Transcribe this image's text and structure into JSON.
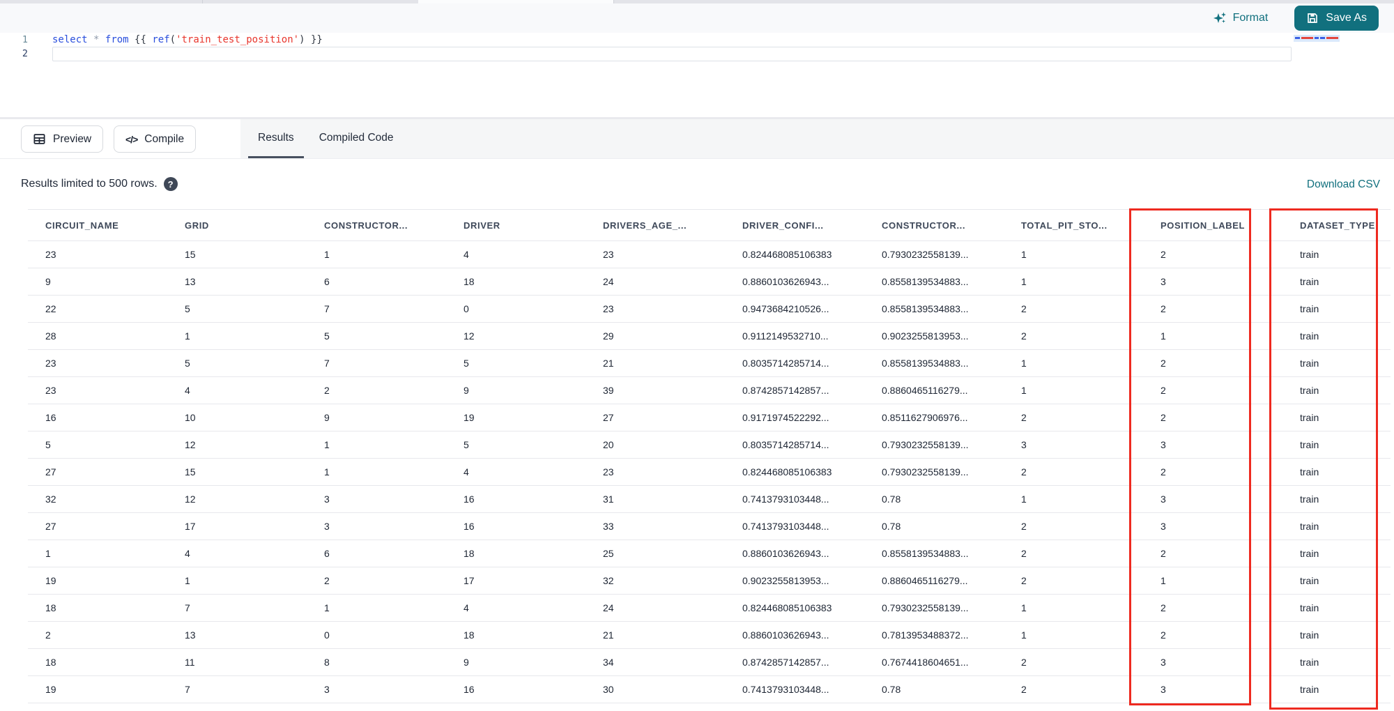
{
  "colors": {
    "accent_teal": "#11707e",
    "annotation_red": "#ee2a20",
    "code_keyword_blue": "#2a4fdd",
    "code_string_red": "#e8362d"
  },
  "toolbar": {
    "format_label": "Format",
    "save_as_label": "Save As"
  },
  "editor": {
    "lines": [
      {
        "number": "1",
        "tokens": [
          [
            "select",
            "kw"
          ],
          [
            " ",
            "plain"
          ],
          [
            "*",
            "op"
          ],
          [
            " ",
            "plain"
          ],
          [
            "from",
            "kw"
          ],
          [
            " ",
            "plain"
          ],
          [
            "{{ ",
            "punc"
          ],
          [
            "ref",
            "fn"
          ],
          [
            "(",
            "punc"
          ],
          [
            "'train_test_position'",
            "str"
          ],
          [
            ")",
            "punc"
          ],
          [
            " }}",
            "punc"
          ]
        ]
      },
      {
        "number": "2",
        "tokens": []
      }
    ]
  },
  "actions": {
    "preview_label": "Preview",
    "compile_label": "Compile"
  },
  "tabs": [
    {
      "label": "Results",
      "active": true
    },
    {
      "label": "Compiled Code",
      "active": false
    }
  ],
  "results_bar": {
    "notice": "Results limited to 500 rows.",
    "download_label": "Download CSV"
  },
  "table": {
    "columns": [
      "CIRCUIT_NAME",
      "GRID",
      "CONSTRUCTOR...",
      "DRIVER",
      "DRIVERS_AGE_...",
      "DRIVER_CONFI...",
      "CONSTRUCTOR...",
      "TOTAL_PIT_STO...",
      "POSITION_LABEL",
      "DATASET_TYPE"
    ],
    "rows": [
      [
        "23",
        "15",
        "1",
        "4",
        "23",
        "0.824468085106383",
        "0.7930232558139...",
        "1",
        "2",
        "train"
      ],
      [
        "9",
        "13",
        "6",
        "18",
        "24",
        "0.8860103626943...",
        "0.8558139534883...",
        "1",
        "3",
        "train"
      ],
      [
        "22",
        "5",
        "7",
        "0",
        "23",
        "0.9473684210526...",
        "0.8558139534883...",
        "2",
        "2",
        "train"
      ],
      [
        "28",
        "1",
        "5",
        "12",
        "29",
        "0.9112149532710...",
        "0.9023255813953...",
        "2",
        "1",
        "train"
      ],
      [
        "23",
        "5",
        "7",
        "5",
        "21",
        "0.8035714285714...",
        "0.8558139534883...",
        "1",
        "2",
        "train"
      ],
      [
        "23",
        "4",
        "2",
        "9",
        "39",
        "0.8742857142857...",
        "0.8860465116279...",
        "1",
        "2",
        "train"
      ],
      [
        "16",
        "10",
        "9",
        "19",
        "27",
        "0.9171974522292...",
        "0.8511627906976...",
        "2",
        "2",
        "train"
      ],
      [
        "5",
        "12",
        "1",
        "5",
        "20",
        "0.8035714285714...",
        "0.7930232558139...",
        "3",
        "3",
        "train"
      ],
      [
        "27",
        "15",
        "1",
        "4",
        "23",
        "0.824468085106383",
        "0.7930232558139...",
        "2",
        "2",
        "train"
      ],
      [
        "32",
        "12",
        "3",
        "16",
        "31",
        "0.7413793103448...",
        "0.78",
        "1",
        "3",
        "train"
      ],
      [
        "27",
        "17",
        "3",
        "16",
        "33",
        "0.7413793103448...",
        "0.78",
        "2",
        "3",
        "train"
      ],
      [
        "1",
        "4",
        "6",
        "18",
        "25",
        "0.8860103626943...",
        "0.8558139534883...",
        "2",
        "2",
        "train"
      ],
      [
        "19",
        "1",
        "2",
        "17",
        "32",
        "0.9023255813953...",
        "0.8860465116279...",
        "2",
        "1",
        "train"
      ],
      [
        "18",
        "7",
        "1",
        "4",
        "24",
        "0.824468085106383",
        "0.7930232558139...",
        "1",
        "2",
        "train"
      ],
      [
        "2",
        "13",
        "0",
        "18",
        "21",
        "0.8860103626943...",
        "0.7813953488372...",
        "1",
        "2",
        "train"
      ],
      [
        "18",
        "11",
        "8",
        "9",
        "34",
        "0.8742857142857...",
        "0.7674418604651...",
        "2",
        "3",
        "train"
      ],
      [
        "19",
        "7",
        "3",
        "16",
        "30",
        "0.7413793103448...",
        "0.78",
        "2",
        "3",
        "train"
      ]
    ],
    "annotated_columns": [
      "POSITION_LABEL",
      "DATASET_TYPE"
    ]
  }
}
